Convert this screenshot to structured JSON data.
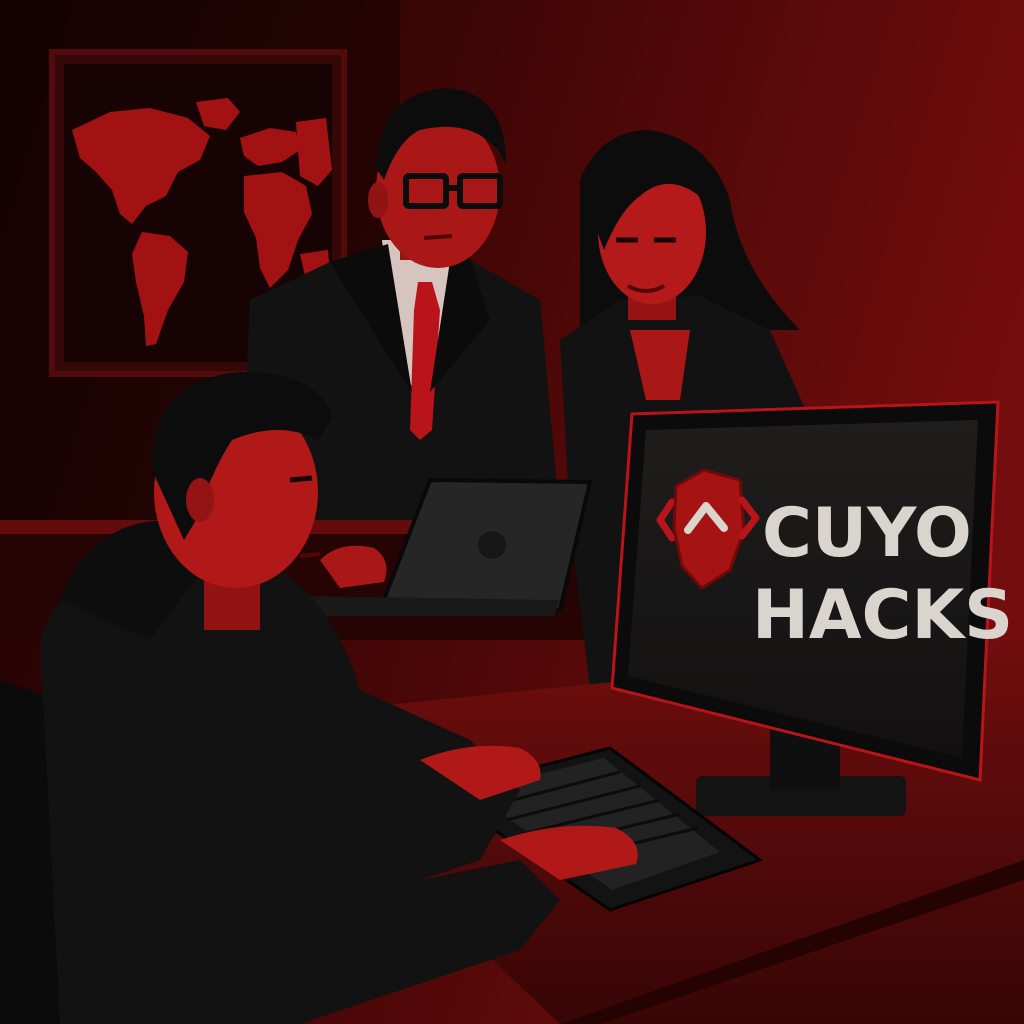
{
  "brand": {
    "line1": "CUYO",
    "line2": "HACKS",
    "logo_icon": "shield-caret-icon"
  },
  "colors": {
    "background_dark": "#1a0505",
    "wall_red": "#7a0d0d",
    "accent_red": "#c8161d",
    "skin_red": "#b01a1a",
    "suit_black": "#141414",
    "screen_black": "#1c1c1c",
    "text_light": "#ece6df"
  },
  "icons": [
    "world-map-icon",
    "shield-caret-icon",
    "code-bracket-left-icon",
    "code-bracket-right-icon"
  ]
}
